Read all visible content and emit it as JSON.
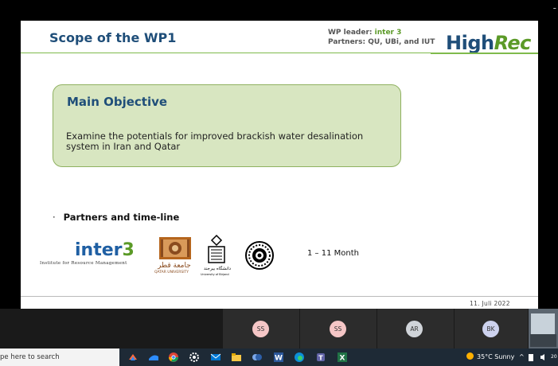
{
  "topbar": {
    "right_glyph": "-"
  },
  "slide": {
    "title": "Scope of the WP1",
    "wp_leader_label": "WP leader:",
    "wp_leader_value": "inter 3",
    "partners_label": "Partners: QU, UBi, and IUT",
    "logo": {
      "part1": "High",
      "part2": "Rec"
    },
    "objective": {
      "heading": "Main Objective",
      "text": "Examine the potentials for improved brackish water desalination system in Iran and Qatar"
    },
    "bullet": {
      "marker": "·",
      "text": "Partners and time-line"
    },
    "partners": {
      "inter3": {
        "word": "inter",
        "digit": "3",
        "subtitle": "Institute for Resource Management"
      },
      "qu": {
        "arabic": "جامعة قطر",
        "name": "QATAR UNIVERSITY"
      },
      "ubi": {
        "arabic": "دانشگاه بیرجند",
        "name": "University of Birjand"
      },
      "iut": {
        "name": ""
      }
    },
    "timeline": "1 – 11 Month",
    "footer_date": "11. Juli 2022"
  },
  "participants": [
    {
      "initials": "SS",
      "color": "#f5c6c6"
    },
    {
      "initials": "SS",
      "color": "#f5c6c6"
    },
    {
      "initials": "AR",
      "color": "#d0d4d9"
    },
    {
      "initials": "BK",
      "color": "#cdd2ee"
    }
  ],
  "taskbar": {
    "search_placeholder": "pe here to search",
    "apps": [
      "zoom-app-icon",
      "remote-app-icon",
      "chrome-icon",
      "settings-icon",
      "mail-icon",
      "file-explorer-icon",
      "generic-app-icon",
      "word-icon",
      "edge-icon",
      "teams-icon",
      "excel-icon"
    ],
    "weather": "35°C  Sunny",
    "tray_chevron": "^",
    "clock_partial": "20"
  }
}
